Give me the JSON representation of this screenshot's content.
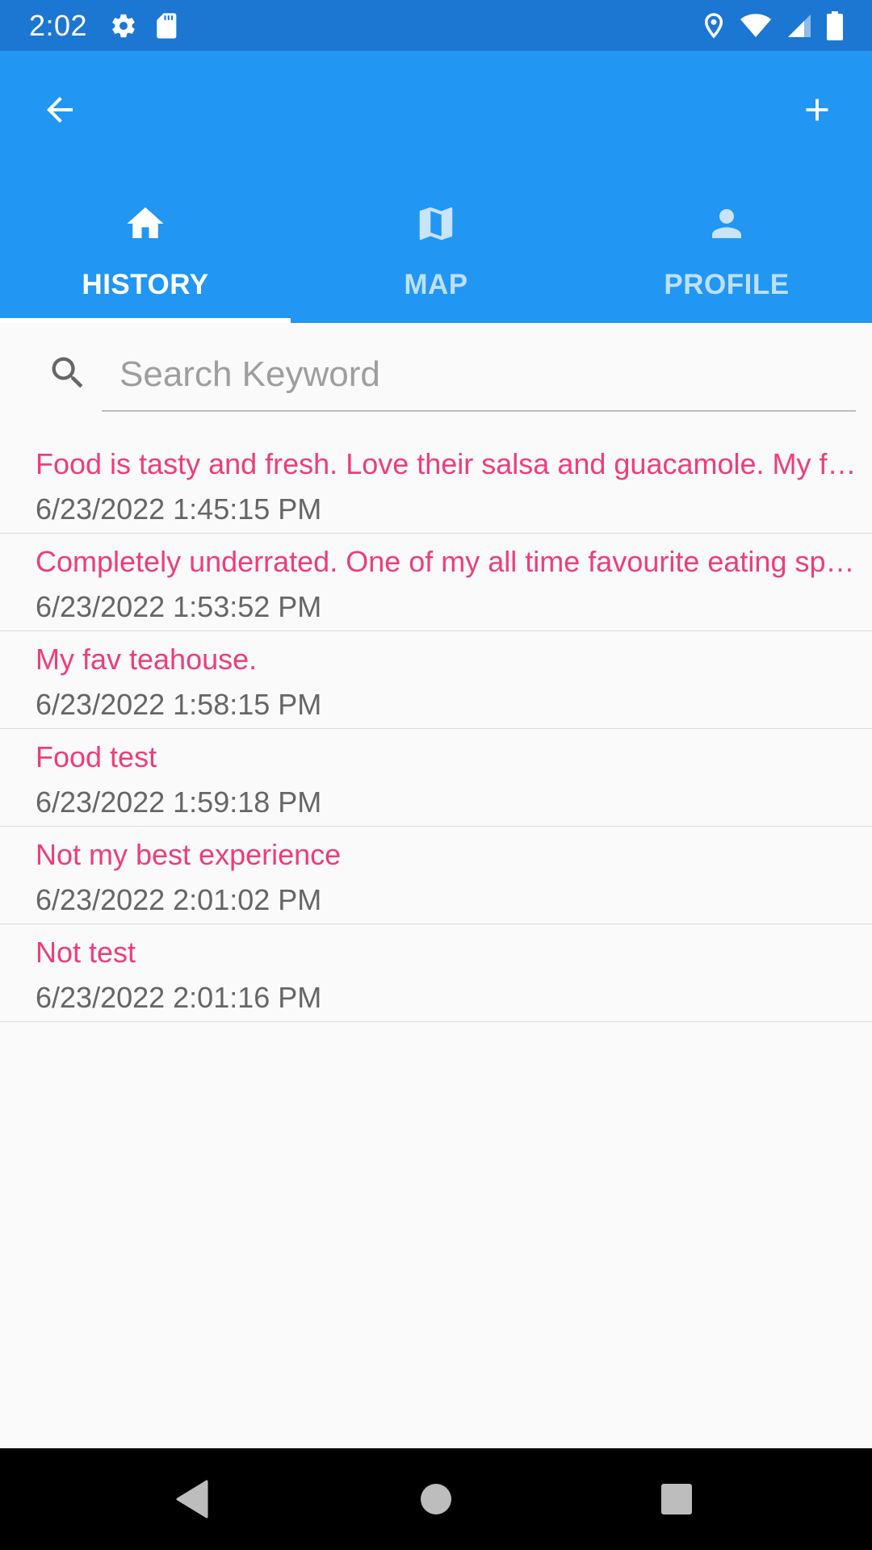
{
  "status_bar": {
    "time": "2:02",
    "icons": [
      "gear-icon",
      "sd-card-icon",
      "location-icon",
      "wifi-icon",
      "signal-icon",
      "battery-icon"
    ]
  },
  "toolbar": {
    "back_icon": "arrow-left-icon",
    "add_icon": "plus-icon"
  },
  "tabs": [
    {
      "label": "HISTORY",
      "icon": "home-icon",
      "active": true
    },
    {
      "label": "MAP",
      "icon": "map-icon",
      "active": false
    },
    {
      "label": "PROFILE",
      "icon": "person-icon",
      "active": false
    }
  ],
  "search": {
    "placeholder": "Search Keyword",
    "value": ""
  },
  "history": [
    {
      "title": "Food is tasty and fresh. Love their salsa and guacamole. My f…",
      "date": "6/23/2022 1:45:15 PM"
    },
    {
      "title": "Completely underrated. One of my all time favourite eating sp…",
      "date": "6/23/2022 1:53:52 PM"
    },
    {
      "title": "My fav teahouse.",
      "date": "6/23/2022 1:58:15 PM"
    },
    {
      "title": "Food test",
      "date": "6/23/2022 1:59:18 PM"
    },
    {
      "title": "Not my best experience",
      "date": "6/23/2022 2:01:02 PM"
    },
    {
      "title": "Not test",
      "date": "6/23/2022 2:01:16 PM"
    }
  ],
  "colors": {
    "status_bar": "#1c77d2",
    "app_bar": "#2196f3",
    "title_text": "#ef3d7a",
    "date_text": "#666666"
  }
}
